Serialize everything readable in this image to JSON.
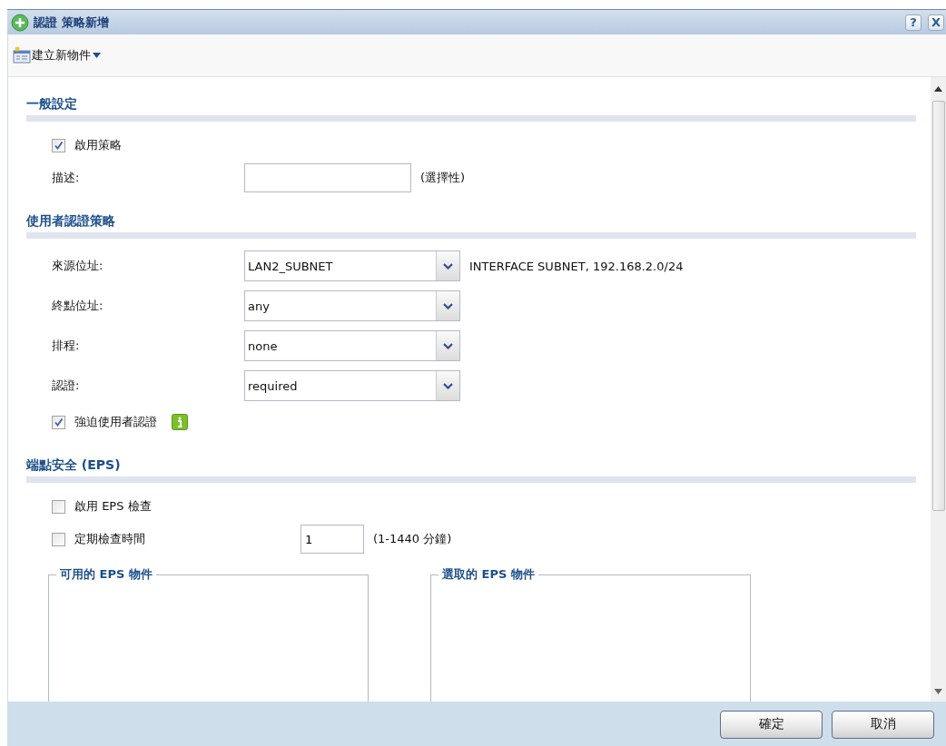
{
  "window": {
    "title": "認證 策略新增",
    "help_button": "?",
    "close_button": "X"
  },
  "toolbar": {
    "menu_label": "建立新物件"
  },
  "sections": [
    {
      "title": "一般設定",
      "items": [
        {
          "kind": "checkbox",
          "label": "啟用策略",
          "checked": true
        },
        {
          "kind": "text",
          "label": "描述:",
          "hint": "(選擇性)"
        }
      ]
    },
    {
      "title": "使用者認證策略",
      "items": [
        {
          "kind": "select",
          "label": "來源位址:",
          "value": "LAN2_SUBNET",
          "hint": "INTERFACE SUBNET, 192.168.2.0/24"
        },
        {
          "kind": "select",
          "label": "終點位址:",
          "value": "any"
        },
        {
          "kind": "select",
          "label": "排程:",
          "value": "none"
        },
        {
          "kind": "select",
          "label": "認證:",
          "value": "required"
        },
        {
          "kind": "checkbox",
          "label": "強迫使用者認證",
          "checked": true,
          "info": true
        }
      ]
    },
    {
      "title": "端點安全 (EPS)",
      "items": [
        {
          "kind": "checkbox",
          "label": "啟用 EPS 檢查",
          "checked": false
        },
        {
          "kind": "checkbox",
          "label": "定期檢查時間",
          "checked": false,
          "value": "1",
          "hint": "(1-1440 分鐘)"
        }
      ],
      "lists": [
        {
          "legend": "可用的 EPS 物件"
        },
        {
          "legend": "選取的 EPS 物件"
        }
      ]
    }
  ],
  "buttons": [
    "確定",
    "取消"
  ]
}
